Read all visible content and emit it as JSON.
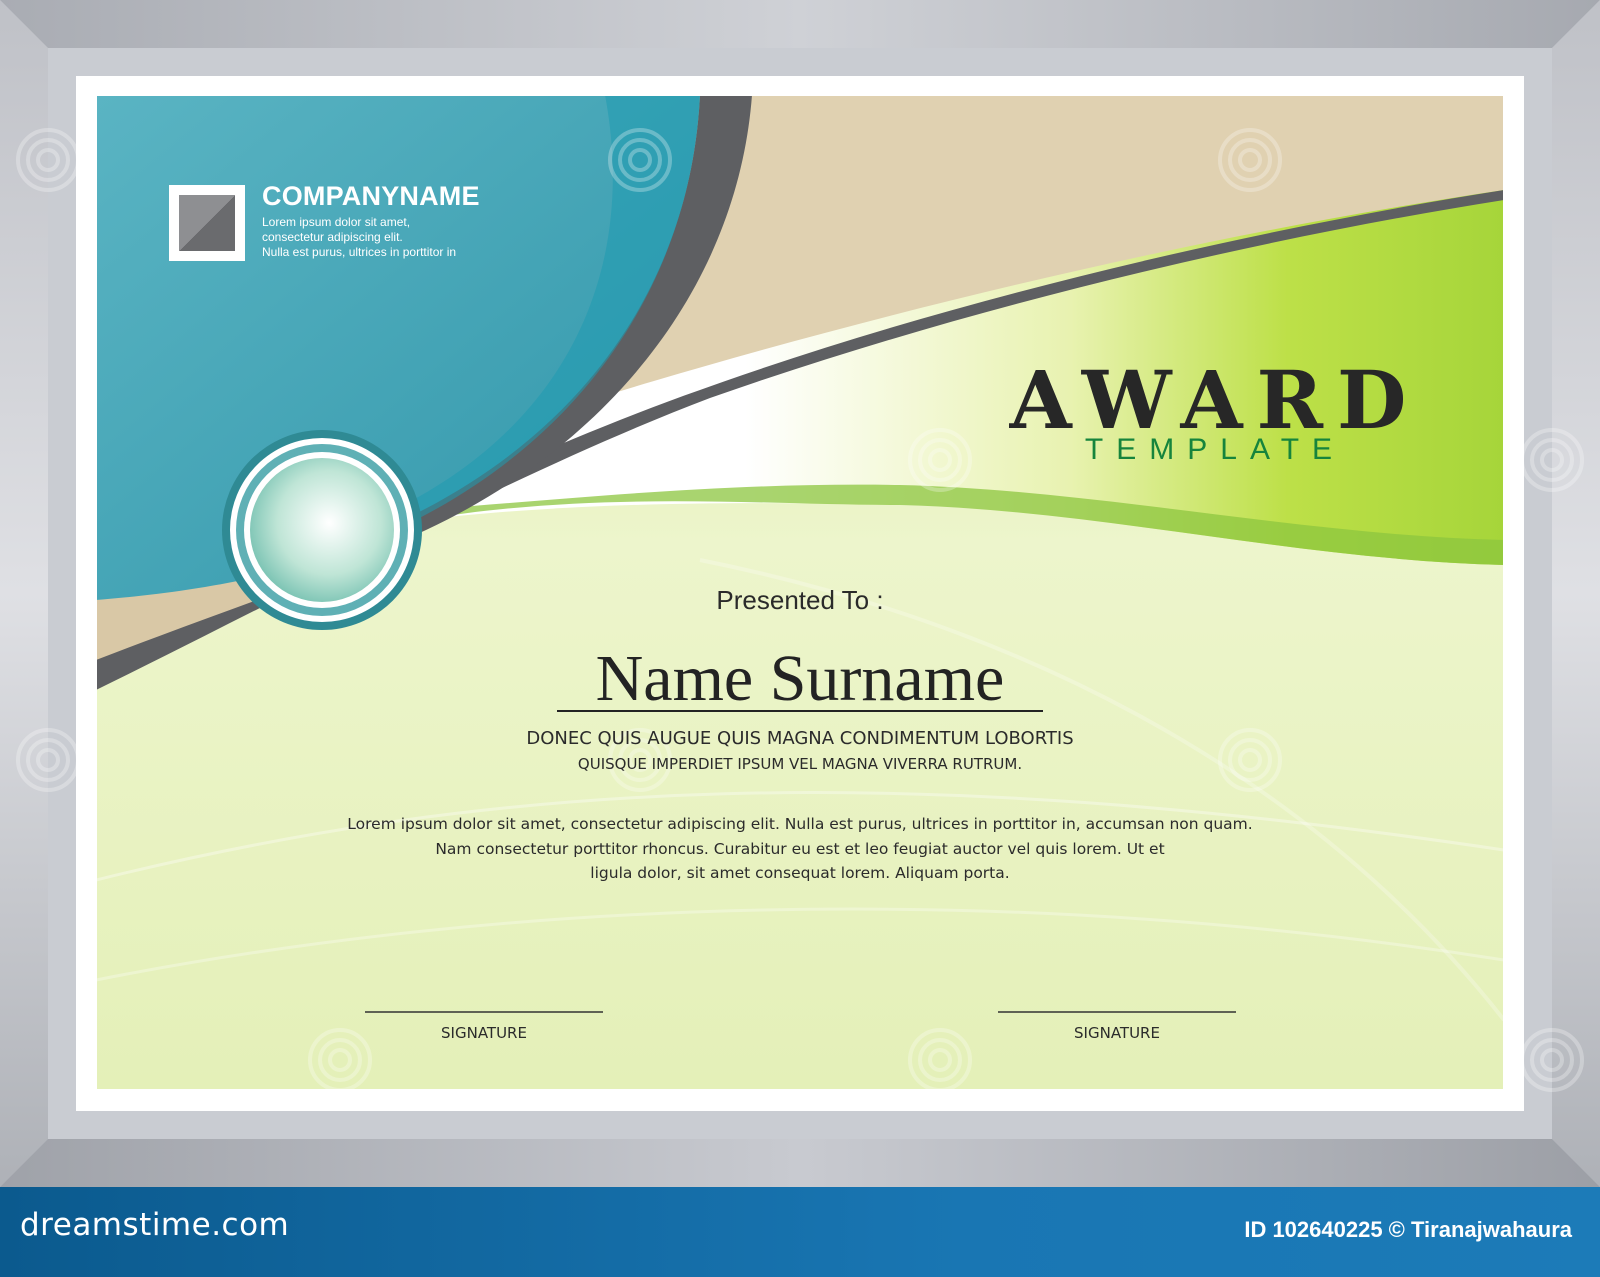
{
  "certificate": {
    "company_name": "COMPANYNAME",
    "company_desc": [
      "Lorem ipsum dolor sit amet,",
      "consectetur adipiscing elit.",
      "Nulla est purus, ultrices in porttitor in"
    ],
    "title": "AWARD",
    "subtitle": "TEMPLATE",
    "presented_to": "Presented To :",
    "recipient_name": "Name Surname",
    "tagline_line1": "DONEC QUIS AUGUE QUIS MAGNA  CONDIMENTUM LOBORTIS",
    "tagline_line2": "QUISQUE IMPERDIET IPSUM VEL MAGNA VIVERRA RUTRUM.",
    "body_lines": [
      "Lorem ipsum dolor sit amet, consectetur adipiscing elit.  Nulla est purus,  ultrices in porttitor in, accumsan non quam.",
      "Nam consectetur porttitor rhoncus. Curabitur eu est et leo  feugiat auctor vel quis lorem. Ut et",
      "ligula dolor,  sit amet consequat  lorem. Aliquam porta."
    ],
    "signature_left": "SIGNATURE",
    "signature_right": "SIGNATURE"
  },
  "footer": {
    "brand": "dreamstime.com",
    "image_id": "ID 102640225 © Tiranajwahaura"
  },
  "watermark_text": "dreamstime",
  "colors": {
    "teal": "#3a9fb0",
    "beige": "#e0d1b1",
    "lime": "#a6d53a",
    "dark_gray": "#5e5f62",
    "title_green": "#16843c",
    "footer_blue": "#1976b3"
  },
  "icons": {
    "logo": "square-logo-icon",
    "seal": "award-seal-icon",
    "watermark": "spiral-watermark-icon"
  }
}
